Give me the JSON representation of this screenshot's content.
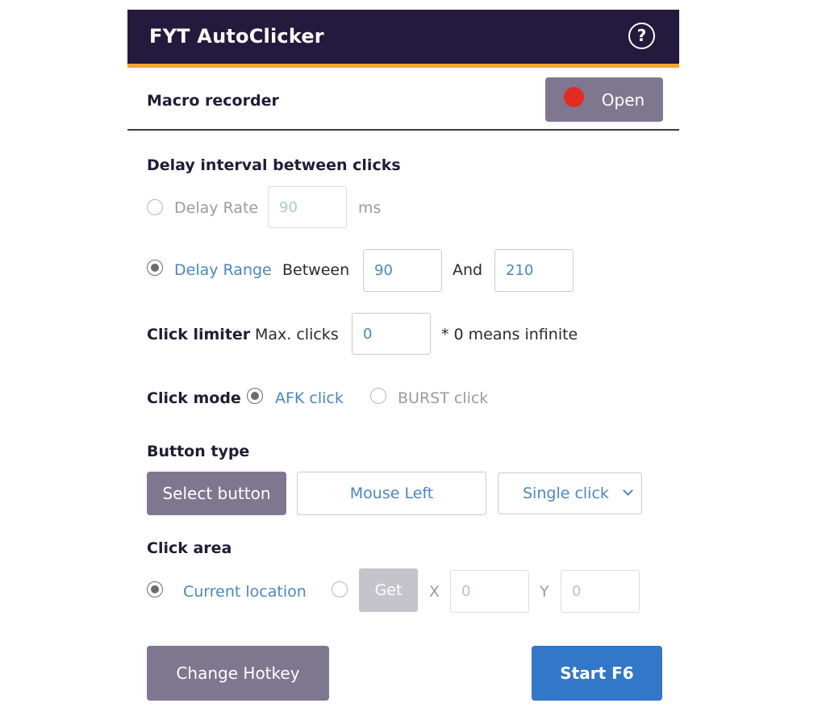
{
  "header": {
    "title": "FYT AutoClicker",
    "help_icon": "question-icon",
    "help_glyph": "?"
  },
  "macro": {
    "label": "Macro recorder",
    "open_label": "Open"
  },
  "delay": {
    "heading": "Delay interval between clicks",
    "rate_label": "Delay Rate",
    "rate_value": "90",
    "rate_unit": "ms",
    "range_label": "Delay Range",
    "between_label": "Between",
    "range_min": "90",
    "and_label": "And",
    "range_max": "210"
  },
  "limiter": {
    "label": "Click limiter",
    "max_label": "Max. clicks",
    "max_value": "0",
    "note": "* 0 means infinite"
  },
  "mode": {
    "label": "Click mode",
    "afk_label": "AFK click",
    "burst_label": "BURST click"
  },
  "button_type": {
    "heading": "Button type",
    "select_label": "Select button",
    "mouse_label": "Mouse Left",
    "click_type": "Single click"
  },
  "area": {
    "heading": "Click area",
    "current_label": "Current location",
    "get_label": "Get",
    "x_label": "X",
    "x_value": "0",
    "y_label": "Y",
    "y_value": "0"
  },
  "footer": {
    "hotkey_label": "Change Hotkey",
    "start_label": "Start F6"
  },
  "colors": {
    "header_bg": "#231a3e",
    "accent": "#f2a72b",
    "primary": "#3277c8",
    "grey_button": "#7f7790",
    "record": "#e32b22"
  }
}
